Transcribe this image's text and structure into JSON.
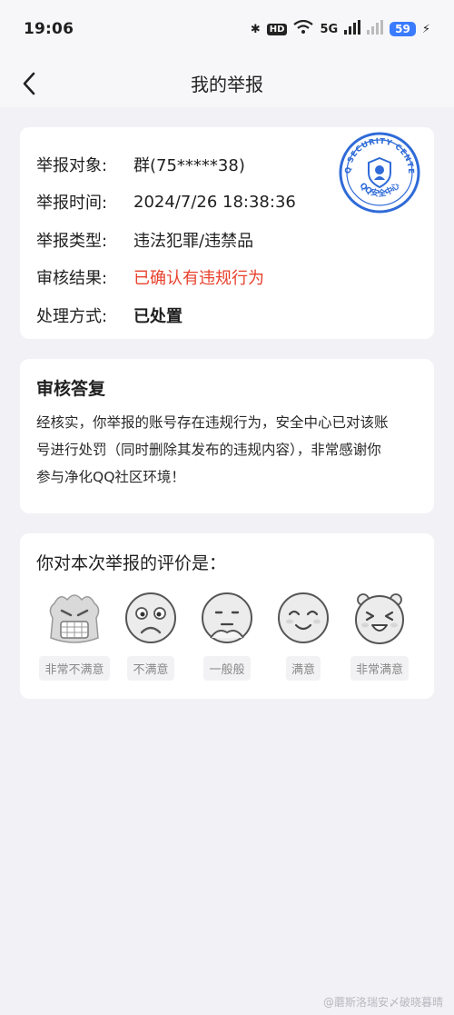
{
  "status_bar": {
    "time": "19:06",
    "hd": "HD",
    "network": "5G",
    "battery": "59"
  },
  "nav": {
    "title": "我的举报"
  },
  "report": {
    "rows": [
      {
        "label": "举报对象:",
        "value": "群(75*****38)"
      },
      {
        "label": "举报时间:",
        "value": "2024/7/26 18:38:36"
      },
      {
        "label": "举报类型:",
        "value": "违法犯罪/违禁品"
      },
      {
        "label": "审核结果:",
        "value": "已确认有违规行为"
      },
      {
        "label": "处理方式:",
        "value": "已处置"
      }
    ],
    "result_color": "#e8412c",
    "stamp": {
      "outer_text": "QQ SECURITY CENTER",
      "inner_text": "QQ安全中心",
      "color": "#2f6bd8"
    }
  },
  "reply": {
    "title": "审核答复",
    "lines": [
      "经核实，你举报的账号存在违规行为，安全中心已对该账",
      "号进行处罚（同时删除其发布的违规内容），非常感谢你",
      "参与净化QQ社区环境！"
    ]
  },
  "rating": {
    "title": "你对本次举报的评价是：",
    "options": [
      {
        "label": "非常不满意",
        "icon": "furious-face-icon"
      },
      {
        "label": "不满意",
        "icon": "frown-face-icon"
      },
      {
        "label": "一般般",
        "icon": "neutral-face-icon"
      },
      {
        "label": "满意",
        "icon": "smile-face-icon"
      },
      {
        "label": "非常满意",
        "icon": "laugh-face-icon"
      }
    ]
  },
  "watermark": "@蘑斯洛瑞安〆破晓暮晴"
}
